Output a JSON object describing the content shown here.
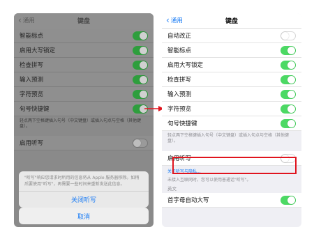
{
  "left_phone": {
    "nav": {
      "back": "通用",
      "title": "键盘"
    },
    "rows": [
      {
        "label": "智能标点",
        "toggle": "on"
      },
      {
        "label": "启用大写锁定",
        "toggle": "on"
      },
      {
        "label": "检查拼写",
        "toggle": "on"
      },
      {
        "label": "输入预测",
        "toggle": "on"
      },
      {
        "label": "字符预览",
        "toggle": "on"
      },
      {
        "label": "句号快捷键",
        "toggle": "on"
      }
    ],
    "note": "轻点两下空格键插入句号（中文键盘）或插入句点与空格（其他键盘）。",
    "dictation_row": {
      "label": "启用听写",
      "toggle": "off"
    },
    "sheet": {
      "message": "\"听写\"响应您请求时所用的信息将从 Apple 服务器移除。如稍后要使用\"听写\"，再需要一些时间来重新发送此信息。",
      "action": "关闭听写",
      "cancel": "取消"
    }
  },
  "right_phone": {
    "nav": {
      "back": "通用",
      "title": "键盘"
    },
    "rows": [
      {
        "label": "自动改正",
        "toggle": "off"
      },
      {
        "label": "智能标点",
        "toggle": "on"
      },
      {
        "label": "启用大写锁定",
        "toggle": "on"
      },
      {
        "label": "检查拼写",
        "toggle": "on"
      },
      {
        "label": "输入预测",
        "toggle": "on"
      },
      {
        "label": "字符预览",
        "toggle": "on"
      },
      {
        "label": "句号快捷键",
        "toggle": "on"
      }
    ],
    "note": "轻点两下空格键插入句号（中文键盘）或插入句点与空格（其他键盘）。",
    "dictation_row": {
      "label": "启用听写",
      "toggle": "off"
    },
    "link": "关于听写与隐私...",
    "sub_note": "未接入互联网时，您可以使用普通话\"听写\"。",
    "section_header": "英文",
    "last_row": {
      "label": "首字母自动大写",
      "toggle": "on"
    }
  },
  "colors": {
    "accent_blue": "#1a7cf5",
    "toggle_green": "#4cd964",
    "highlight_red": "#e0141e"
  }
}
